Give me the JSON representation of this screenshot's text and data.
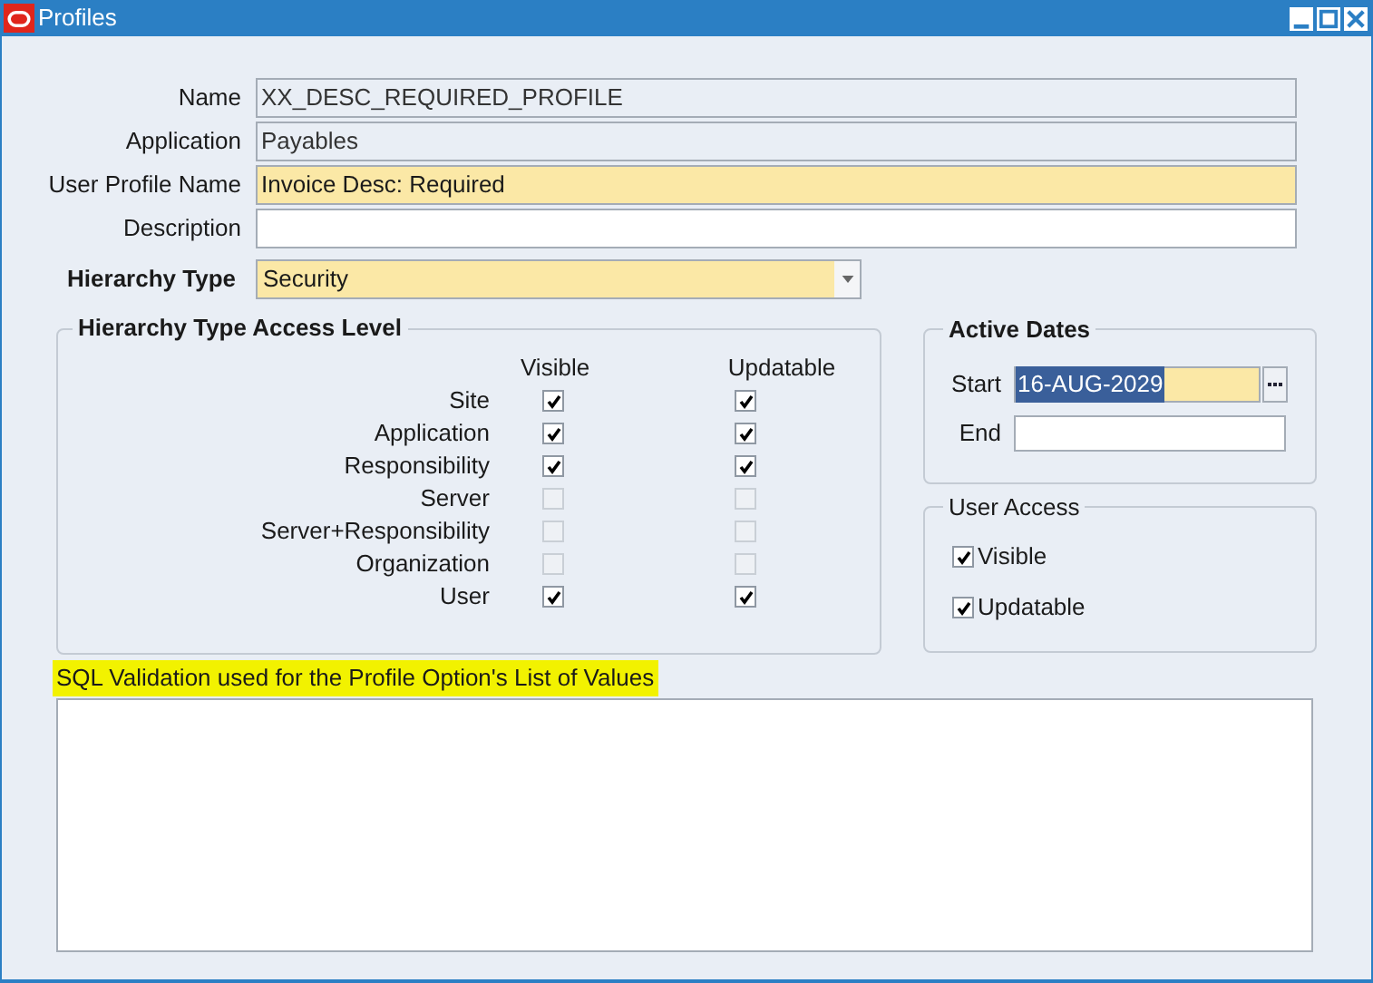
{
  "window": {
    "title": "Profiles"
  },
  "fields": [
    {
      "label": "Name",
      "value": "XX_DESC_REQUIRED_PROFILE",
      "kind": "readonly"
    },
    {
      "label": "Application",
      "value": "Payables",
      "kind": "readonly"
    },
    {
      "label": "User Profile Name",
      "value": "Invoice Desc: Required",
      "kind": "required"
    },
    {
      "label": "Description",
      "kind": "text"
    }
  ],
  "hierarchy_type": {
    "label": "Hierarchy Type",
    "value": "Security"
  },
  "access_level": {
    "title": "Hierarchy Type Access Level",
    "columns": [
      "Visible",
      "Updatable"
    ],
    "rows": [
      {
        "label": "Site",
        "visible": true,
        "updatable": true,
        "disabled": false
      },
      {
        "label": "Application",
        "visible": true,
        "updatable": true,
        "disabled": false
      },
      {
        "label": "Responsibility",
        "visible": true,
        "updatable": true,
        "disabled": false
      },
      {
        "label": "Server",
        "visible": false,
        "updatable": false,
        "disabled": true
      },
      {
        "label": "Server+Responsibility",
        "visible": false,
        "updatable": false,
        "disabled": true
      },
      {
        "label": "Organization",
        "visible": false,
        "updatable": false,
        "disabled": true
      },
      {
        "label": "User",
        "visible": true,
        "updatable": true,
        "disabled": false
      }
    ]
  },
  "active_dates": {
    "title": "Active Dates",
    "start_label": "Start",
    "start": "16-AUG-2029",
    "end_label": "End"
  },
  "user_access": {
    "title": "User Access",
    "options": [
      {
        "label": "Visible",
        "checked": true
      },
      {
        "label": "Updatable",
        "checked": true
      }
    ]
  },
  "sql_validation": {
    "label": "SQL Validation used for the Profile Option's List of Values",
    "highlighted": true
  }
}
